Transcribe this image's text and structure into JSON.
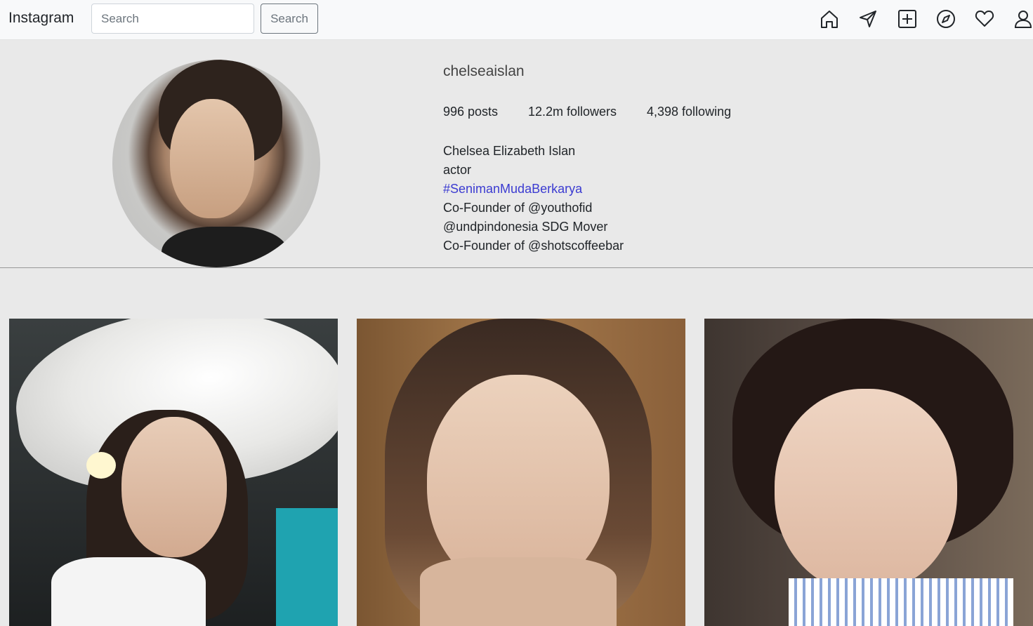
{
  "navbar": {
    "brand": "Instagram",
    "search_placeholder": "Search",
    "search_button": "Search",
    "icons": [
      "home-icon",
      "send-icon",
      "add-post-icon",
      "explore-icon",
      "heart-icon",
      "profile-icon"
    ]
  },
  "profile": {
    "username": "chelseaislan",
    "stats": {
      "posts": "996 posts",
      "followers": "12.2m followers",
      "following": "4,398 following"
    },
    "bio": {
      "name": "Chelsea Elizabeth Islan",
      "occupation": "actor",
      "hashtag": "#SenimanMudaBerkarya",
      "line1": "Co-Founder of @youthofid",
      "line2": "@undpindonesia SDG Mover",
      "line3": "Co-Founder of @shotscoffeebar"
    }
  },
  "colors": {
    "navbar_bg": "#f8f9fa",
    "page_bg": "#e9e9e9",
    "hashtag": "#3b3bd1",
    "outline_button": "#6c757d"
  }
}
